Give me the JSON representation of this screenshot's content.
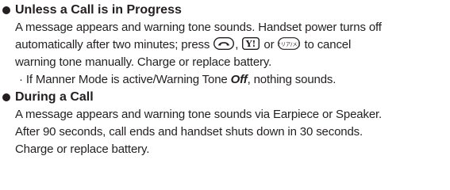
{
  "sections": [
    {
      "heading": "Unless a Call is in Progress",
      "line1": "A message appears and warning tone sounds. Handset power turns off",
      "line2_pre": "automatically after two minutes; press",
      "line2_sep1": ",",
      "line2_sep2": "or",
      "line2_post": "to cancel",
      "line3": "warning tone manually. Charge or replace battery.",
      "note_pre": "·  If Manner Mode is active/Warning Tone",
      "note_em": "Off",
      "note_post": ", nothing sounds.",
      "keys": {
        "end_key": "end-call-key-icon",
        "yahoo_key": "Y!",
        "clear_key": "クリア/メモ"
      }
    },
    {
      "heading": "During a Call",
      "line1": "A message appears and warning tone sounds via Earpiece or Speaker.",
      "line2": "After 90 seconds, call ends and handset shuts down in 30 seconds.",
      "line3": "Charge or replace battery."
    }
  ]
}
